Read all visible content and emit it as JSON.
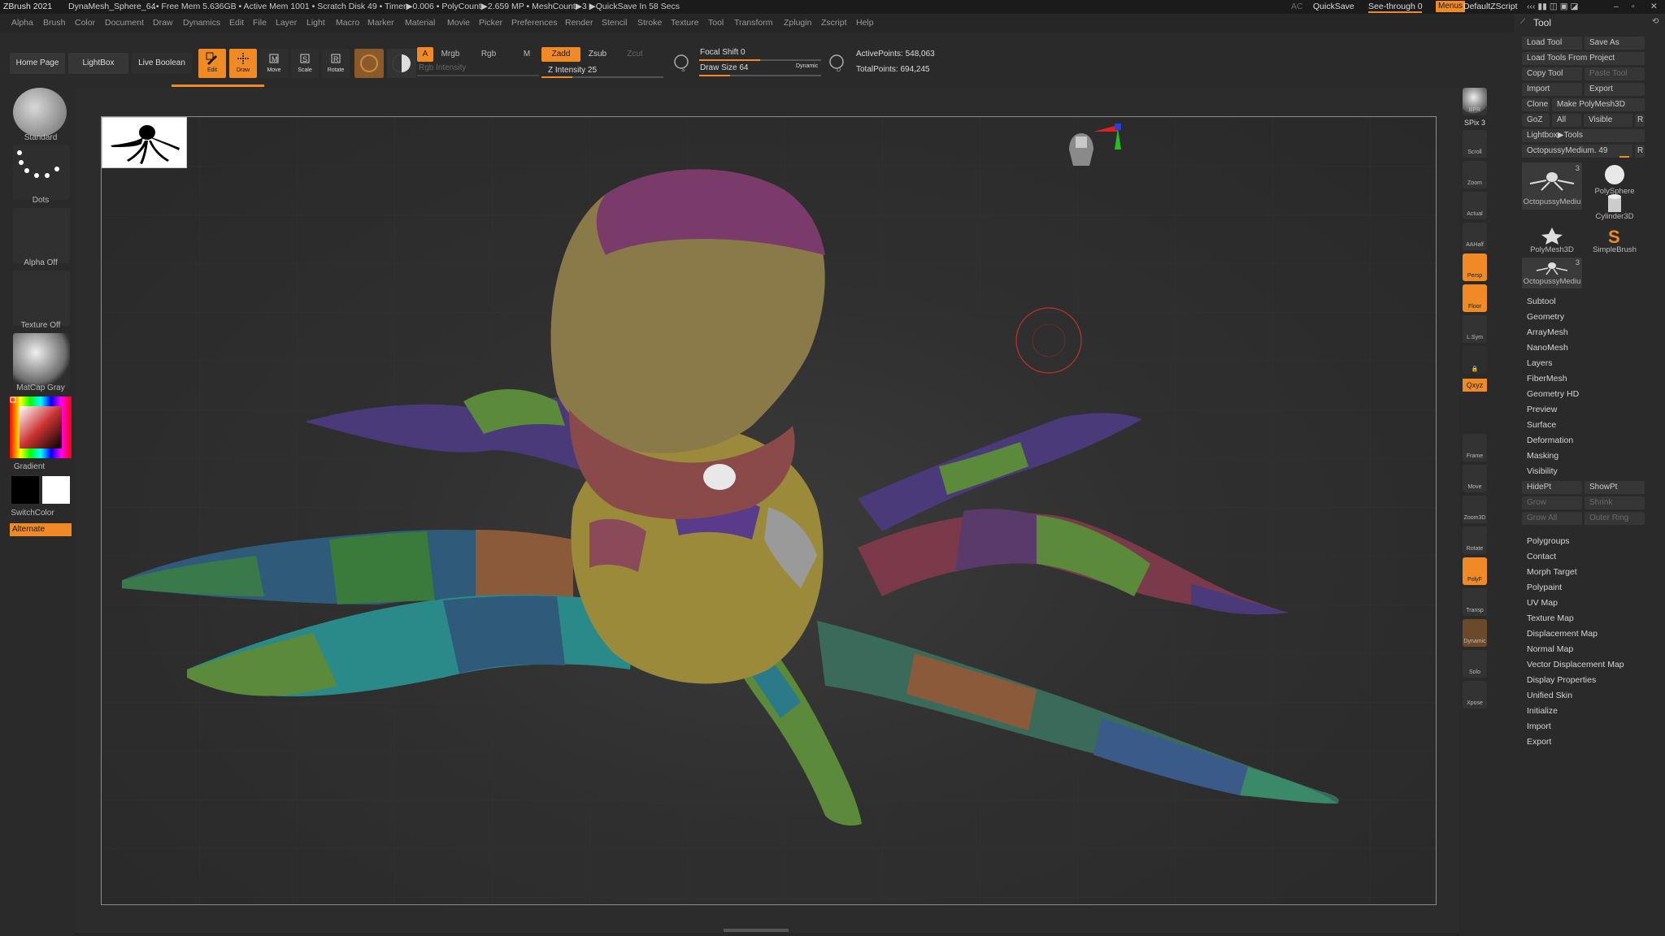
{
  "titlebar": {
    "app": "ZBrush 2021",
    "doc": "DynaMesh_Sphere_64",
    "stats": "..• Free Mem 5.636GB • Active Mem 1001 • Scratch Disk 49 •  Timer▶0.006 • PolyCount▶2.659 MP  • MeshCount▶3  ▶QuickSave In 58 Secs",
    "ac": "AC",
    "quicksave": "QuickSave",
    "see_through": "See-through  0",
    "menus": "Menus",
    "default_zscript": "DefaultZScript"
  },
  "menubar": [
    "Alpha",
    "Brush",
    "Color",
    "Document",
    "Draw",
    "Dynamics",
    "Edit",
    "File",
    "Layer",
    "Light",
    "Macro",
    "Marker",
    "Material",
    "Movie",
    "Picker",
    "Preferences",
    "Render",
    "Stencil",
    "Stroke",
    "Texture",
    "Tool",
    "Transform",
    "Zplugin",
    "Zscript",
    "Help"
  ],
  "toolbar": {
    "home_page": "Home Page",
    "lightbox": "LightBox",
    "live_boolean": "Live Boolean",
    "edit": "Edit",
    "draw": "Draw",
    "move": "Move",
    "scale": "Scale",
    "rotate": "Rotate",
    "a": "A",
    "mrgb": "Mrgb",
    "rgb": "Rgb",
    "m": "M",
    "zadd": "Zadd",
    "zsub": "Zsub",
    "zcut": "Zcut",
    "rgb_intensity": "Rgb Intensity",
    "z_intensity": "Z Intensity 25",
    "focal_shift": "Focal Shift 0",
    "draw_size": "Draw Size 64",
    "dynamic": "Dynamic",
    "active_points": "ActivePoints: 548,063",
    "total_points": "TotalPoints: 694,245",
    "z_intensity_level": 0.25,
    "draw_size_level": 0.25,
    "focal_shift_level": 0.5
  },
  "leftshelf": {
    "standard": "Standard",
    "dots": "Dots",
    "alpha_off": "Alpha Off",
    "texture_off": "Texture Off",
    "matcap": "MatCap Gray",
    "gradient": "Gradient",
    "switchcolor": "SwitchColor",
    "alternate": "Alternate"
  },
  "rightshelf": [
    "BPR",
    "SPix 3",
    "Scroll",
    "Zoom",
    "Actual",
    "AAHalf",
    "Persp",
    "Floor",
    "L.Sym",
    "",
    "Qxyz",
    "",
    "",
    "Frame",
    "Move",
    "Zoom3D",
    "Rotate",
    "PolyF",
    "Transp",
    "Dynamic",
    "Solo",
    "Xpose"
  ],
  "tool": {
    "title": "Tool",
    "load_tool": "Load Tool",
    "save_as": "Save As",
    "load_from_project": "Load Tools From Project",
    "copy_tool": "Copy Tool",
    "paste_tool": "Paste Tool",
    "import": "Import",
    "export": "Export",
    "clone": "Clone",
    "make_polymesh": "Make PolyMesh3D",
    "goz": "GoZ",
    "all": "All",
    "visible": "Visible",
    "r": "R",
    "lightbox_tools": "Lightbox▶Tools",
    "current_tool": "OctopussyMedium. 49",
    "tiles": [
      {
        "label": "OctopussyMediu",
        "count": "3"
      },
      {
        "label": "PolySphere",
        "count": ""
      },
      {
        "label": "Cylinder3D",
        "count": ""
      },
      {
        "label": "PolyMesh3D",
        "count": ""
      },
      {
        "label": "SimpleBrush",
        "count": ""
      },
      {
        "label": "OctopussyMediu",
        "count": "3"
      }
    ],
    "subpalettes_a": [
      "Subtool",
      "Geometry",
      "ArrayMesh",
      "NanoMesh",
      "Layers",
      "FiberMesh",
      "Geometry HD",
      "Preview",
      "Surface",
      "Deformation",
      "Masking",
      "Visibility"
    ],
    "visibility": {
      "hidept": "HidePt",
      "showpt": "ShowPt",
      "grow": "Grow",
      "shrink": "Shrink",
      "grow_all": "Grow All",
      "outer_ring": "Outer Ring"
    },
    "subpalettes_b": [
      "Polygroups",
      "Contact",
      "Morph Target",
      "Polypaint",
      "UV Map",
      "Texture Map",
      "Displacement Map",
      "Normal Map",
      "Vector Displacement Map",
      "Display Properties",
      "Unified Skin",
      "Initialize",
      "Import",
      "Export"
    ]
  },
  "colors": {
    "accent": "#f08a24",
    "bg": "#262626",
    "panel": "#2a2a2a"
  }
}
